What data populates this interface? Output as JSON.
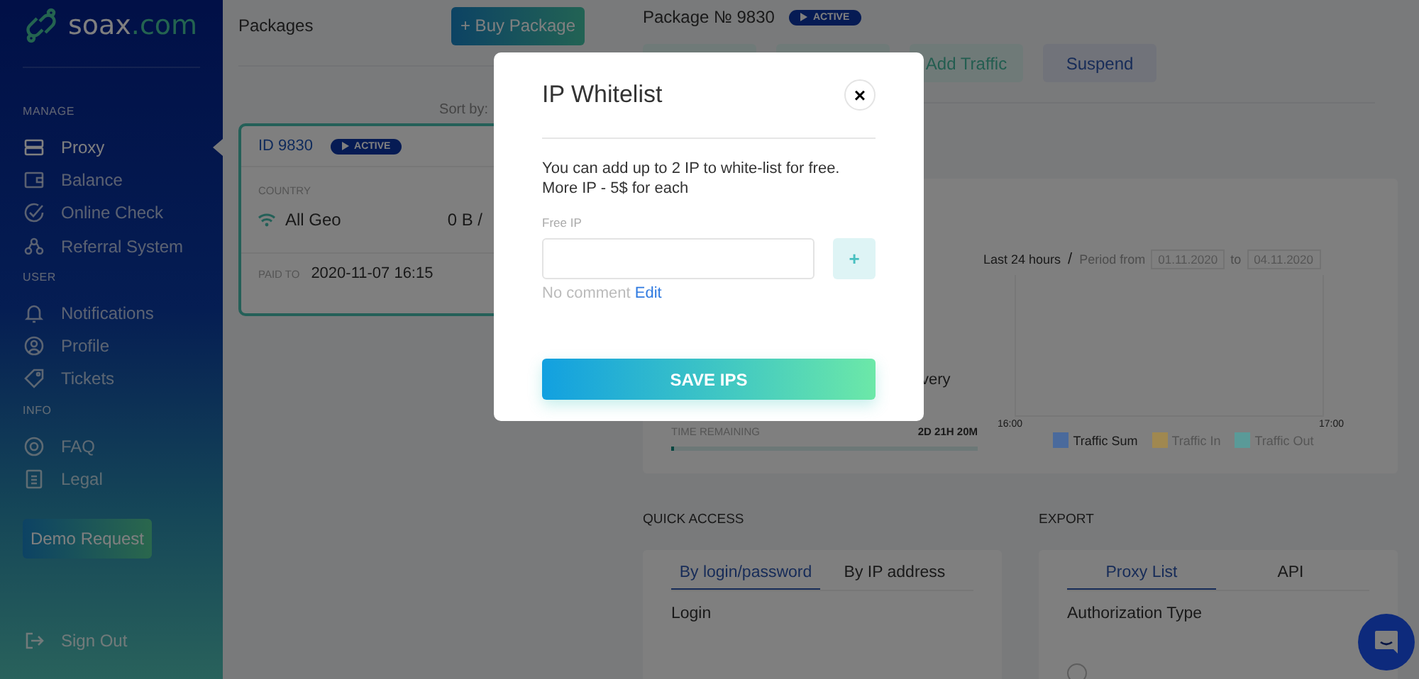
{
  "sidebar": {
    "logo": {
      "name": "soax",
      "suffix": ".com"
    },
    "sections": [
      {
        "title": "MANAGE",
        "items": [
          {
            "label": "Proxy",
            "selected": true
          },
          {
            "label": "Balance",
            "selected": false
          },
          {
            "label": "Online Check",
            "selected": false
          },
          {
            "label": "Referral System",
            "selected": false
          }
        ]
      },
      {
        "title": "USER",
        "items": [
          {
            "label": "Notifications",
            "selected": false
          },
          {
            "label": "Profile",
            "selected": false
          },
          {
            "label": "Tickets",
            "selected": false
          }
        ]
      },
      {
        "title": "INFO",
        "items": [
          {
            "label": "FAQ",
            "selected": false
          },
          {
            "label": "Legal",
            "selected": false
          }
        ]
      }
    ],
    "demo_button": "Demo Request",
    "sign_out": "Sign Out"
  },
  "packages": {
    "title": "Packages",
    "buy_button": "+ Buy Package",
    "sort_label": "Sort by:",
    "card": {
      "id": "ID 9830",
      "status": "ACTIVE",
      "country_header": "COUNTRY",
      "country": "All Geo",
      "traffic": "0 B /",
      "paid_label": "PAID TO",
      "paid_date": "2020-11-07 16:15"
    }
  },
  "package": {
    "title": "Package № 9830",
    "status": "ACTIVE",
    "actions": [
      {
        "kind": "teal"
      },
      {
        "kind": "teal"
      },
      {
        "kind": "teal",
        "label": "Add Traffic"
      },
      {
        "kind": "blue",
        "label": "Suspend"
      }
    ]
  },
  "stats": {
    "note": "very",
    "time_label": "TIME REMAINING",
    "time_value": "2D 21H 20M",
    "level": 0.01,
    "period": {
      "preset": "Last 24 hours",
      "separator": "/",
      "from_label": "Period from",
      "from": "01.11.2020",
      "to_label": "to",
      "to": "04.11.2020"
    },
    "axis_labels": [
      "16:00",
      "17:00"
    ],
    "legend": [
      {
        "label": "Traffic Sum",
        "color": "#4a6a9c",
        "on": true
      },
      {
        "label": "Traffic In",
        "color": "#a08850",
        "on": false
      },
      {
        "label": "Traffic Out",
        "color": "#5a9a98",
        "on": false
      }
    ]
  },
  "quick_access": {
    "title": "QUICK ACCESS",
    "tabs": [
      {
        "label": "By login/password",
        "selected": true
      },
      {
        "label": "By IP address",
        "selected": false
      }
    ],
    "field_label": "Login"
  },
  "export": {
    "title": "EXPORT",
    "tabs": [
      {
        "label": "Proxy List",
        "selected": true
      },
      {
        "label": "API",
        "selected": false
      }
    ],
    "field_label": "Authorization Type",
    "radio": {
      "selected": false
    }
  },
  "modal": {
    "title": "IP Whitelist",
    "close": "×",
    "text": "You can add up to 2 IP to white-list for free. More IP - 5$ for each",
    "field_label": "Free IP",
    "add_button": "+",
    "comment": "No comment",
    "edit_link": "Edit",
    "save_button": "SAVE IPS"
  }
}
